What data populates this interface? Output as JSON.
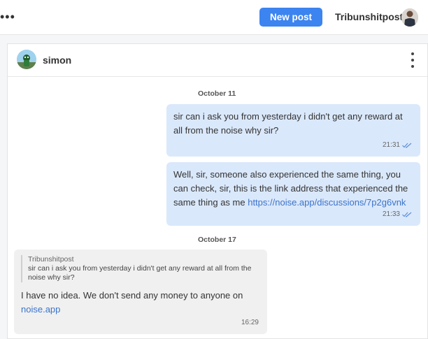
{
  "topbar": {
    "menu_glyph": "•••",
    "new_post_label": "New post",
    "username": "Tribunshitpost"
  },
  "chat": {
    "contact_name": "simon",
    "messages": [
      {
        "date_label": "October 11",
        "text": "sir can i ask you from yesterday i didn't get any reward at all from the noise why sir?",
        "time": "21:31",
        "direction": "outgoing"
      },
      {
        "text_before_link": "Well, sir, someone also experienced the same thing, you can check, sir, this is the link address that experienced the same thing as me ",
        "link": "https://noise.app/discussions/7p2g6vnk",
        "time": "21:33",
        "direction": "outgoing"
      },
      {
        "date_label": "October 17",
        "quote_author": "Tribunshitpost",
        "quote_text": "sir can i ask you from yesterday i didn't get any reward at all from the noise why sir?",
        "text_before_link": "I have no idea. We don't send any money to anyone on ",
        "link": "noise.app",
        "time": "16:29",
        "direction": "incoming"
      }
    ]
  },
  "colors": {
    "accent": "#3c84f0",
    "outgoing_bubble": "#dae8fb",
    "incoming_bubble": "#f0f0f0",
    "link": "#3b73c9"
  },
  "icons": [
    "more-horizontal-icon",
    "user-avatar-icon",
    "contact-avatar-icon",
    "more-vertical-icon",
    "double-check-icon"
  ]
}
